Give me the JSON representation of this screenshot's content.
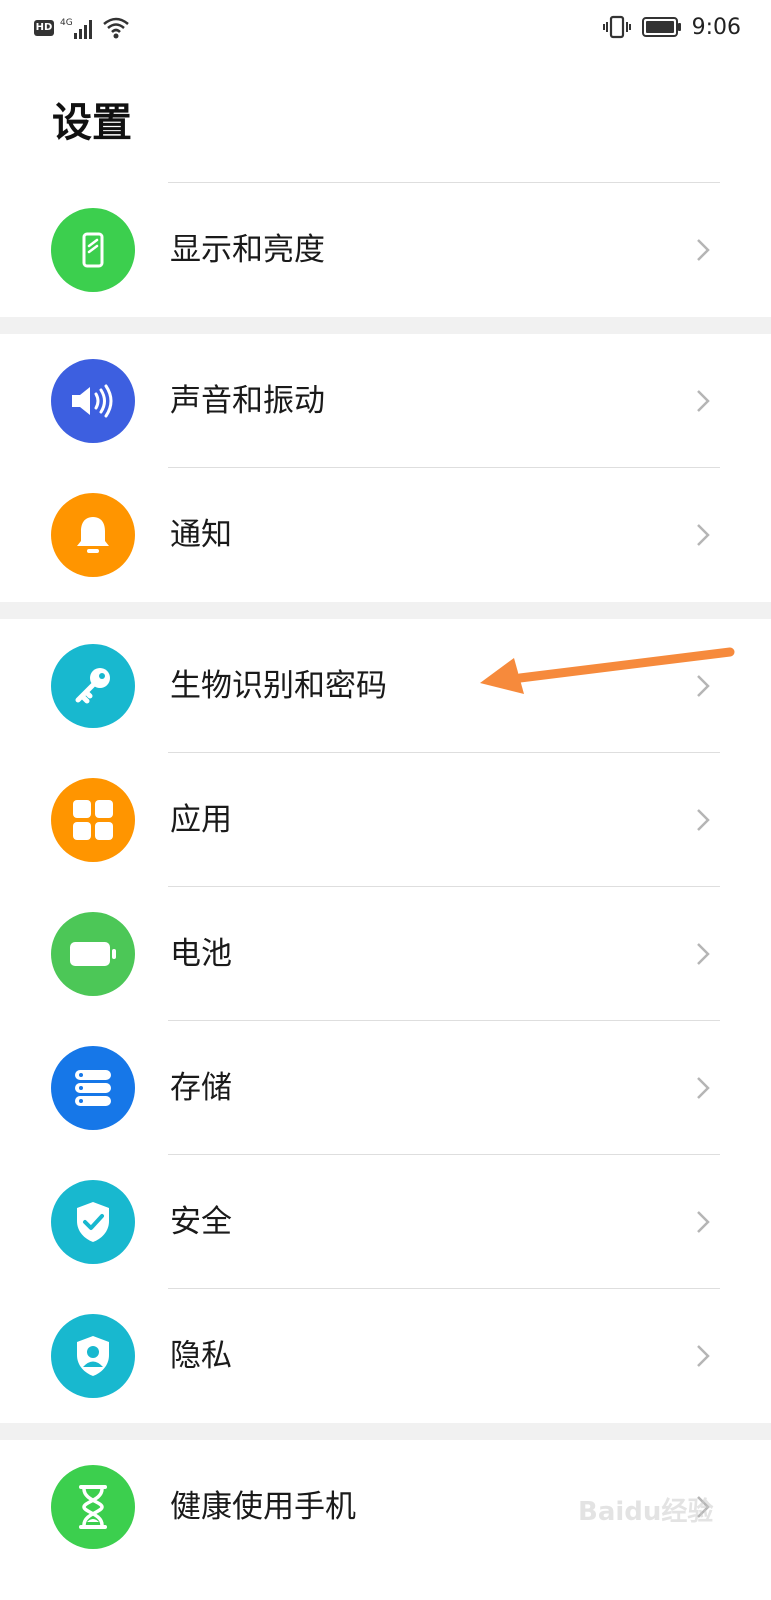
{
  "status_bar": {
    "hd_label": "HD",
    "network_label": "4G",
    "time": "9:06"
  },
  "page": {
    "title": "设置"
  },
  "settings_items": [
    {
      "label": "显示和亮度",
      "icon": "display-icon",
      "color": "#3ccf4e"
    },
    {
      "label": "声音和振动",
      "icon": "speaker-icon",
      "color": "#3d5fe0"
    },
    {
      "label": "通知",
      "icon": "bell-icon",
      "color": "#ff9500"
    },
    {
      "label": "生物识别和密码",
      "icon": "key-icon",
      "color": "#18b8cf"
    },
    {
      "label": "应用",
      "icon": "apps-grid-icon",
      "color": "#ff9500"
    },
    {
      "label": "电池",
      "icon": "battery-icon",
      "color": "#4cc757"
    },
    {
      "label": "存储",
      "icon": "storage-icon",
      "color": "#1677e8"
    },
    {
      "label": "安全",
      "icon": "shield-check-icon",
      "color": "#18b8cf"
    },
    {
      "label": "隐私",
      "icon": "privacy-shield-icon",
      "color": "#18b8cf"
    },
    {
      "label": "健康使用手机",
      "icon": "hourglass-icon",
      "color": "#3ccf4e"
    }
  ],
  "annotation": {
    "arrow_color": "#f68a3c"
  },
  "watermark": {
    "text": "Baidu经验"
  }
}
